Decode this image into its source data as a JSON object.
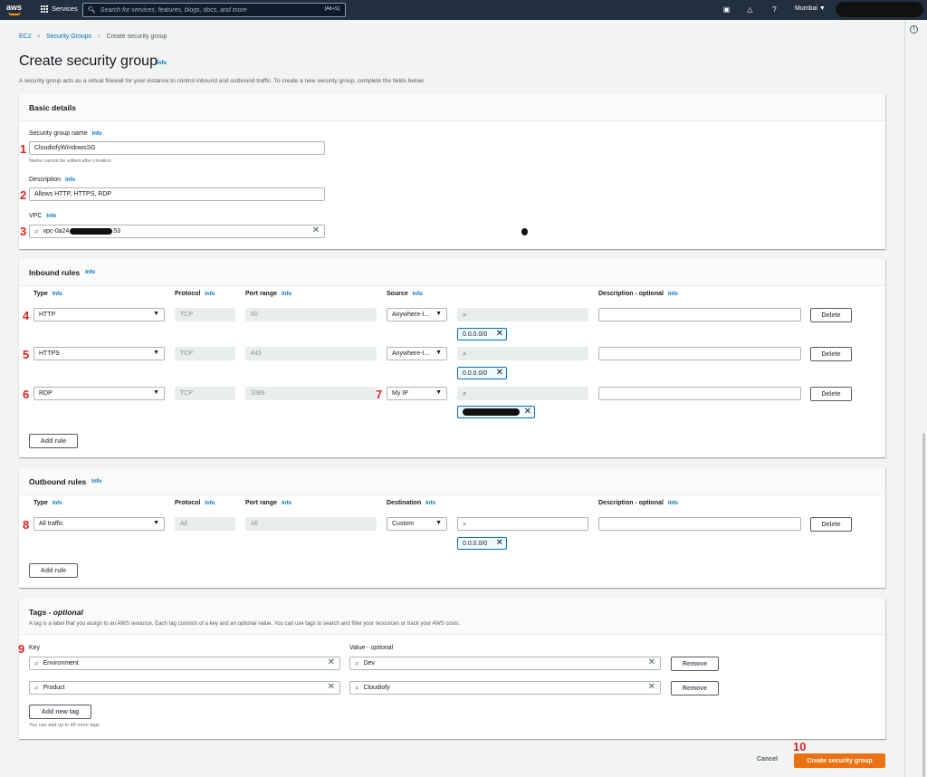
{
  "nav": {
    "logo": "aws",
    "services_label": "Services",
    "search_placeholder": "Search for services, features, blogs, docs, and more",
    "search_shortcut": "[Alt+S]",
    "region": "Mumbai ▼"
  },
  "breadcrumb": {
    "root": "EC2",
    "parent": "Security Groups",
    "current": "Create security group"
  },
  "page": {
    "title": "Create security group",
    "info": "Info",
    "description": "A security group acts as a virtual firewall for your instance to control inbound and outbound traffic. To create a new security group, complete the fields below."
  },
  "basic": {
    "heading": "Basic details",
    "info": "Info",
    "name_label": "Security group name",
    "name_value": "CloudiofyWindowsSG",
    "name_hint": "Name cannot be edited after creation.",
    "desc_label": "Description",
    "desc_value": "Allows HTTP, HTTPS, RDP",
    "vpc_label": "VPC",
    "vpc_prefix": "vpc-0a24",
    "vpc_suffix": "53"
  },
  "inbound": {
    "heading": "Inbound rules",
    "info": "Info",
    "col_type": "Type",
    "col_protocol": "Protocol",
    "col_port": "Port range",
    "col_source": "Source",
    "col_desc": "Description - optional",
    "rules": [
      {
        "type": "HTTP",
        "protocol": "TCP",
        "port": "80",
        "source": "Anywhere-I...",
        "cidr": "0.0.0.0/0"
      },
      {
        "type": "HTTPS",
        "protocol": "TCP",
        "port": "443",
        "source": "Anywhere-I...",
        "cidr": "0.0.0.0/0"
      },
      {
        "type": "RDP",
        "protocol": "TCP",
        "port": "3389",
        "source": "My IP",
        "cidr": ""
      }
    ],
    "delete_label": "Delete",
    "add_rule": "Add rule"
  },
  "outbound": {
    "heading": "Outbound rules",
    "info": "Info",
    "col_type": "Type",
    "col_protocol": "Protocol",
    "col_port": "Port range",
    "col_dest": "Destination",
    "col_desc": "Description - optional",
    "rules": [
      {
        "type": "All traffic",
        "protocol": "All",
        "port": "All",
        "dest": "Custom",
        "cidr": "0.0.0.0/0"
      }
    ],
    "delete_label": "Delete",
    "add_rule": "Add rule"
  },
  "tags": {
    "heading": "Tags - ",
    "heading_opt": "optional",
    "description": "A tag is a label that you assign to an AWS resource. Each tag consists of a key and an optional value. You can use tags to search and filter your resources or track your AWS costs.",
    "key_label": "Key",
    "value_label": "Value - ",
    "value_opt": "optional",
    "items": [
      {
        "key": "Environment",
        "value": "Dev"
      },
      {
        "key": "Product",
        "value": "Cloudiofy"
      }
    ],
    "remove_label": "Remove",
    "add_tag": "Add new tag",
    "limit_hint": "You can add up to 48 more tags"
  },
  "footer": {
    "cancel": "Cancel",
    "create": "Create security group"
  },
  "annotations": [
    "1",
    "2",
    "3",
    "4",
    "5",
    "6",
    "7",
    "8",
    "9",
    "10"
  ]
}
